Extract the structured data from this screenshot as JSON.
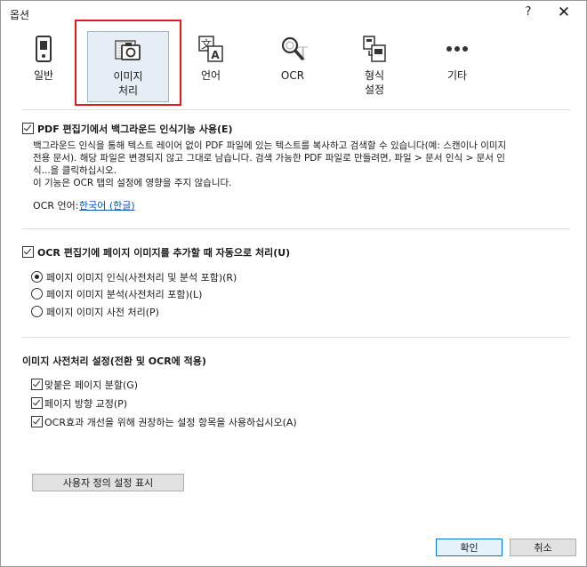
{
  "window": {
    "title": "옵션",
    "help": "?",
    "close": "✕"
  },
  "tabs": [
    {
      "id": "general",
      "label": "일반",
      "icon": "toggle-switch-icon"
    },
    {
      "id": "image",
      "label_line1": "이미지",
      "label_line2": "처리",
      "icon": "image-processing-icon",
      "selected": true
    },
    {
      "id": "language",
      "label": "언어",
      "icon": "language-icon"
    },
    {
      "id": "ocr",
      "label": "OCR",
      "icon": "ocr-search-icon"
    },
    {
      "id": "format",
      "label_line1": "형식",
      "label_line2": "설정",
      "icon": "format-settings-icon"
    },
    {
      "id": "other",
      "label": "기타",
      "icon": "more-dots-icon"
    }
  ],
  "pdf_section": {
    "checkbox_label": "PDF 편집기에서 백그라운드 인식기능 사용(E)",
    "desc_line1": "백그라운드 인식을 통해 텍스트 레이어 없이 PDF 파일에 있는 텍스트를 복사하고 검색할 수 있습니다(예: 스캔이나 이미지",
    "desc_line2": "전용 문서). 해당 파일은 변경되지 않고 그대로 남습니다. 검색 가능한 PDF 파일로 만들려면, 파일 > 문서 인식 > 문서 인",
    "desc_line3": "식...을 클릭하십시오.",
    "desc_line4": "이 기능은 OCR 탭의 설정에 영향을 주지 않습니다.",
    "ocr_lang_label": "OCR 언어:",
    "ocr_lang_value": "한국어 (한글)"
  },
  "ocr_section": {
    "checkbox_label": "OCR 편집기에 페이지 이미지를 추가할 때 자동으로 처리(U)",
    "radio_options": [
      {
        "label": "페이지 이미지 인식(사전처리 및 분석 포함)(R)",
        "selected": true
      },
      {
        "label": "페이지 이미지 분석(사전처리 포함)(L)",
        "selected": false
      },
      {
        "label": "페이지 이미지 사전 처리(P)",
        "selected": false
      }
    ]
  },
  "preprocess_section": {
    "heading": "이미지 사전처리 설정(전환 및 OCR에 적용)",
    "checkboxes": [
      {
        "label": "맞붙은 페이지 분할(G)",
        "checked": true
      },
      {
        "label": "페이지 방향 교정(P)",
        "checked": true
      },
      {
        "label": "OCR효과 개선을 위해 권장하는 설정 항목을 사용하십시오(A)",
        "checked": true
      }
    ],
    "custom_button": "사용자 정의 설정 표시"
  },
  "footer": {
    "ok": "확인",
    "cancel": "취소"
  }
}
